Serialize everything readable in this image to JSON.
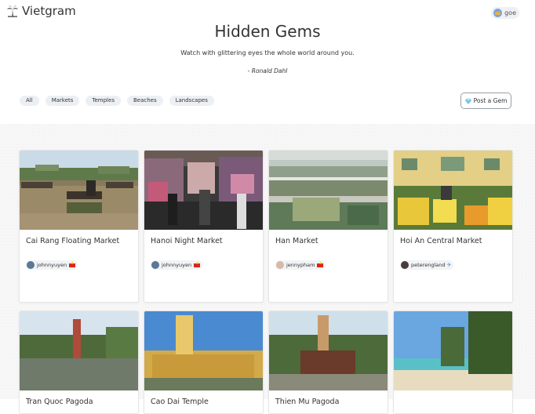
{
  "app": {
    "name": "Vietgram"
  },
  "user": {
    "name": "goe"
  },
  "hero": {
    "title": "Hidden Gems",
    "quote": "Watch with glittering eyes the whole world around you.",
    "author": "- Ronald Dahl"
  },
  "filters": [
    "All",
    "Markets",
    "Temples",
    "Beaches",
    "Landscapes"
  ],
  "actions": {
    "post_label": "Post a Gem"
  },
  "cards": [
    {
      "title": "Cai Rang Floating Market",
      "author": "johnnyuyen",
      "badge": "vietnam-flag"
    },
    {
      "title": "Hanoi Night Market",
      "author": "johnnyuyen",
      "badge": "vietnam-flag"
    },
    {
      "title": "Han Market",
      "author": "jennypham",
      "badge": "vietnam-flag"
    },
    {
      "title": "Hoi An Central Market",
      "author": "peterengland",
      "badge": "airplane"
    },
    {
      "title": "Tran Quoc Pagoda"
    },
    {
      "title": "Cao Dai Temple"
    },
    {
      "title": "Thien Mu Pagoda"
    },
    {
      "title": ""
    }
  ],
  "colors": {
    "accent": "#da251d",
    "chip_bg": "#eceff3",
    "page_bg": "#f7f7f7"
  },
  "icons": {
    "logo": "palm-tree-icon",
    "post": "gem-icon",
    "user": "globe-avatar-icon"
  }
}
